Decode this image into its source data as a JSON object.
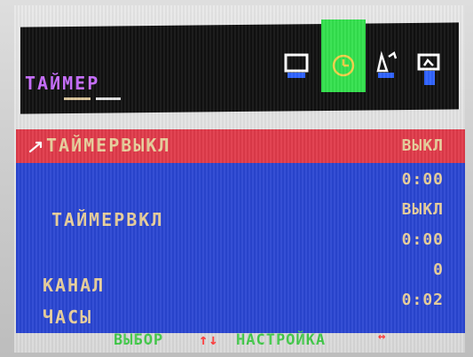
{
  "colors": {
    "header_bg": "#111111",
    "title": "#c86dff",
    "selected_icon_bg": "#33e14d",
    "list_bg": "#2a46d2",
    "selected_row_bg": "#e03a4a",
    "item_text": "#e8cf9c",
    "footer_green": "#42c94a",
    "footer_red": "#ff3b3b"
  },
  "menu": {
    "title": "ТАЙМЕР",
    "icons": [
      "picture-icon",
      "timer-icon",
      "setup-icon",
      "function-icon"
    ],
    "selected_icon": "timer-icon"
  },
  "items": [
    {
      "label": "ТАЙМЕРВЫКЛ",
      "value": "ВЫКЛ",
      "selected": true
    },
    {
      "label": "",
      "value": "0:00"
    },
    {
      "label": "ТАЙМЕРВКЛ",
      "value": "ВЫКЛ"
    },
    {
      "label": "",
      "value": "0:00"
    },
    {
      "label": "КАНАЛ",
      "value": "0"
    },
    {
      "label": "ЧАСЫ",
      "value": "0:02"
    }
  ],
  "footer": {
    "select_label": "ВЫБОР",
    "select_arrows": "↑↓",
    "adjust_label": "НАСТРОЙКА",
    "adjust_arrows": "↔"
  }
}
